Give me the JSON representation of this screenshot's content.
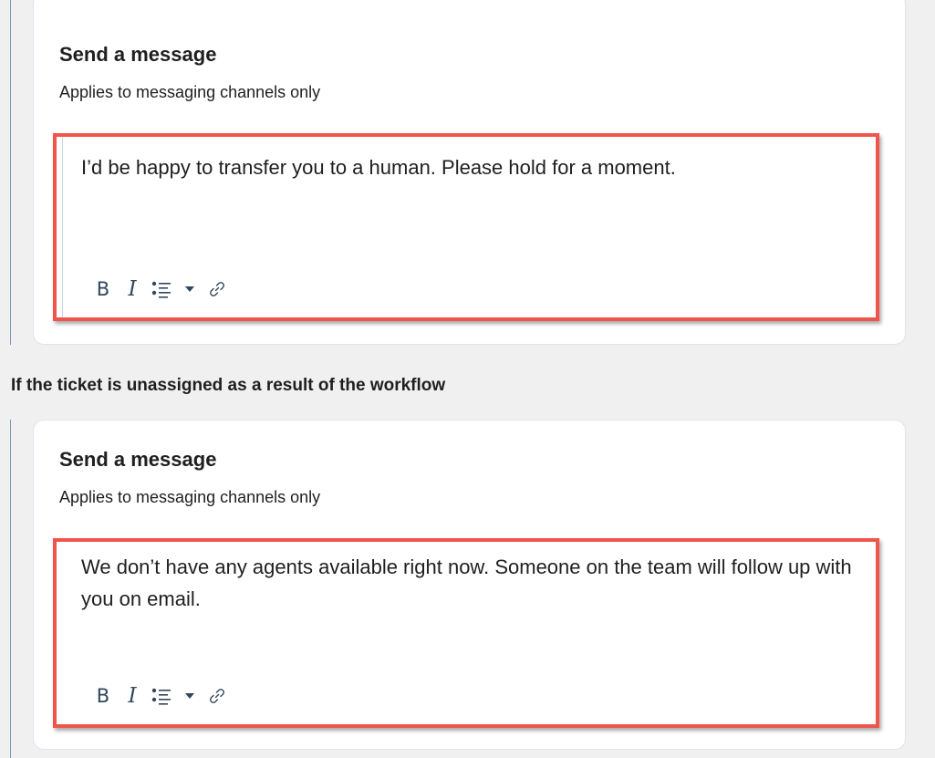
{
  "section_heading": "If the ticket is unassigned as a result of the workflow",
  "cards": [
    {
      "title": "Send a message",
      "subtitle": "Applies to messaging channels only",
      "message": "I’d be happy to transfer you to a human. Please hold for a moment.",
      "toolbar": {
        "bold": "B",
        "italic": "I"
      }
    },
    {
      "title": "Send a message",
      "subtitle": "Applies to messaging channels only",
      "message": "We don’t have any agents available right now. Someone on the team will follow up with you on email.",
      "toolbar": {
        "bold": "B",
        "italic": "I"
      }
    }
  ],
  "colors": {
    "highlight_border": "#f0554c",
    "page_background": "#f0f0f0",
    "card_background": "#ffffff",
    "text": "#1f1f1f"
  },
  "icons": [
    "bold-icon",
    "italic-icon",
    "bulleted-list-icon",
    "caret-down-icon",
    "link-icon"
  ]
}
